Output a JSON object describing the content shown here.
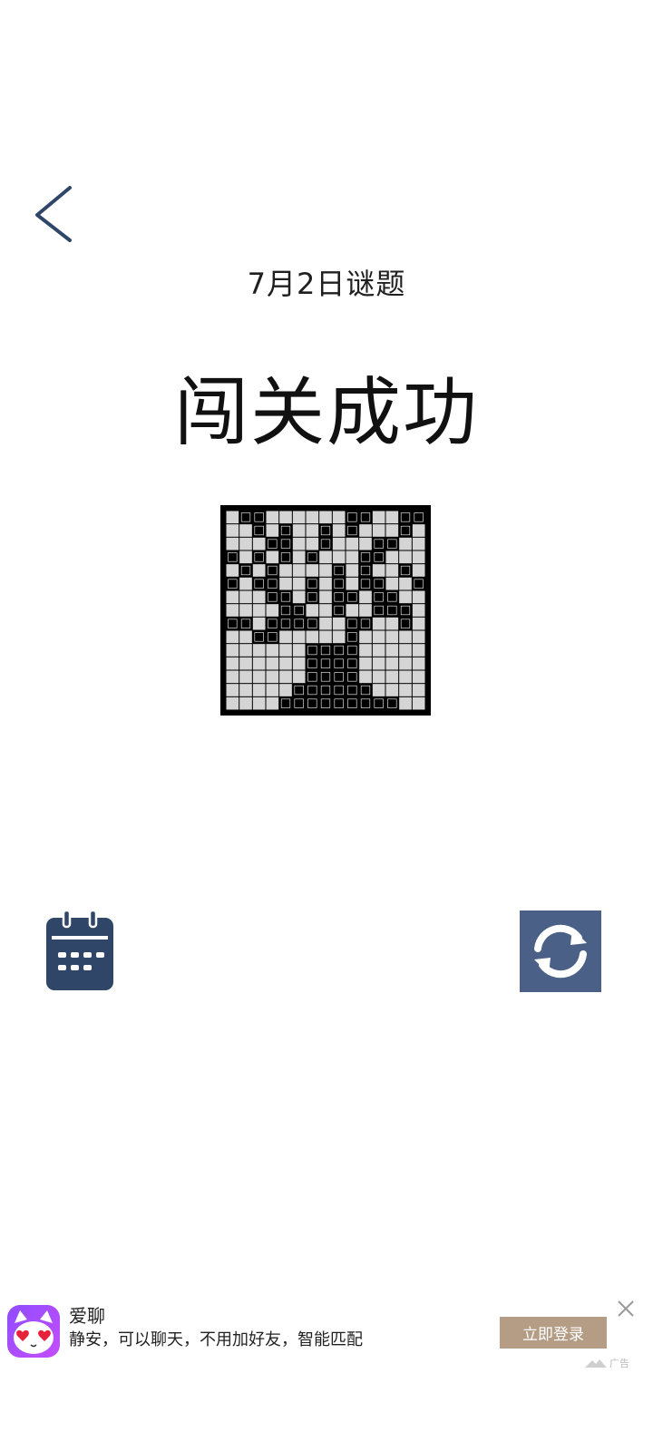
{
  "header": {
    "back_icon": "chevron-left-icon",
    "puzzle_date": "7月2日谜题",
    "status_title": "闯关成功"
  },
  "puzzle": {
    "rows": 15,
    "cols": 15,
    "filled_color": "#000000",
    "empty_color": "#d5d5d5",
    "grid": [
      "011000000110011",
      "001010010100010",
      "000110010001100",
      "101010100011000",
      "010100001010010",
      "101100101011001",
      "000110101101100",
      "000011001001110",
      "110111100110010",
      "001100000100000",
      "000000111100000",
      "000000111100000",
      "000000111100000",
      "000001111110000",
      "000011111111100"
    ]
  },
  "controls": {
    "calendar_icon": "calendar-icon",
    "refresh_icon": "refresh-icon",
    "accent_color": "#2f4668",
    "refresh_bg_color": "#4a6087"
  },
  "ad": {
    "app_name": "爱聊",
    "description": "静安，可以聊天，不用加好友，智能匹配",
    "cta_label": "立即登录",
    "ad_label": "广告",
    "cta_color": "#b59d85"
  }
}
